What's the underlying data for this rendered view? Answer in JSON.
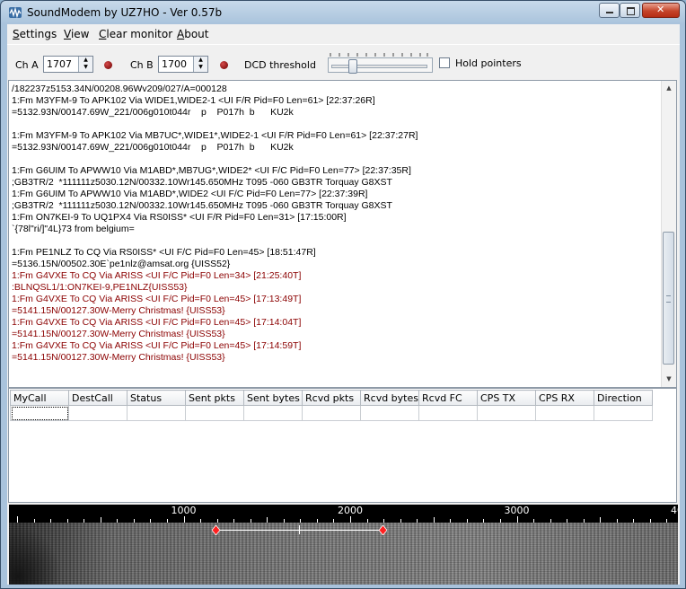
{
  "window": {
    "title": "SoundModem by UZ7HO - Ver 0.57b"
  },
  "menu": [
    {
      "label": "Settings",
      "key": "S"
    },
    {
      "label": "View",
      "key": "V"
    },
    {
      "label": "Clear monitor",
      "key": "C"
    },
    {
      "label": "About",
      "key": "A"
    }
  ],
  "toolbar": {
    "cha_label": "Ch A",
    "cha_value": "1707",
    "chb_label": "Ch B",
    "chb_value": "1700",
    "dcd_label": "DCD threshold",
    "dcd_level": 0.2,
    "hold_label": "Hold pointers",
    "hold_checked": false
  },
  "monitor": {
    "lines": [
      {
        "text": "/182237z5153.34N/00208.96Wv209/027/A=000128",
        "color": "black"
      },
      {
        "text": "1:Fm M3YFM-9 To APK102 Via WIDE1,WIDE2-1 <UI F/R Pid=F0 Len=61> [22:37:26R]",
        "color": "black"
      },
      {
        "text": "=5132.93N/00147.69W_221/006g010t044r    p    P017h  b      KU2k",
        "color": "black"
      },
      {
        "text": "",
        "color": "black"
      },
      {
        "text": "1:Fm M3YFM-9 To APK102 Via MB7UC*,WIDE1*,WIDE2-1 <UI F/R Pid=F0 Len=61> [22:37:27R]",
        "color": "black"
      },
      {
        "text": "=5132.93N/00147.69W_221/006g010t044r    p    P017h  b      KU2k",
        "color": "black"
      },
      {
        "text": "",
        "color": "black"
      },
      {
        "text": "1:Fm G6UIM To APWW10 Via M1ABD*,MB7UG*,WIDE2* <UI F/C Pid=F0 Len=77> [22:37:35R]",
        "color": "black"
      },
      {
        "text": ";GB3TR/2  *111111z5030.12N/00332.10Wr145.650MHz T095 -060 GB3TR Torquay G8XST",
        "color": "black"
      },
      {
        "text": "1:Fm G6UIM To APWW10 Via M1ABD*,WIDE2 <UI F/C Pid=F0 Len=77> [22:37:39R]",
        "color": "black"
      },
      {
        "text": ";GB3TR/2  *111111z5030.12N/00332.10Wr145.650MHz T095 -060 GB3TR Torquay G8XST",
        "color": "black"
      },
      {
        "text": "1:Fm ON7KEI-9 To UQ1PX4 Via RS0ISS* <UI F/R Pid=F0 Len=31> [17:15:00R]",
        "color": "black"
      },
      {
        "text": "`{78l\"ri/]\"4L}73 from belgium=",
        "color": "black"
      },
      {
        "text": "",
        "color": "black"
      },
      {
        "text": "1:Fm PE1NLZ To CQ Via RS0ISS* <UI F/C Pid=F0 Len=45> [18:51:47R]",
        "color": "black"
      },
      {
        "text": "=5136.15N/00502.30E`pe1nlz@amsat.org {UISS52}",
        "color": "black"
      },
      {
        "text": "1:Fm G4VXE To CQ Via ARISS <UI F/C Pid=F0 Len=34> [21:25:40T]",
        "color": "red"
      },
      {
        "text": ":BLNQSL1/1:ON7KEI-9,PE1NLZ{UISS53}",
        "color": "red"
      },
      {
        "text": "1:Fm G4VXE To CQ Via ARISS <UI F/C Pid=F0 Len=45> [17:13:49T]",
        "color": "red"
      },
      {
        "text": "=5141.15N/00127.30W-Merry Christmas! {UISS53}",
        "color": "red"
      },
      {
        "text": "1:Fm G4VXE To CQ Via ARISS <UI F/C Pid=F0 Len=45> [17:14:04T]",
        "color": "red"
      },
      {
        "text": "=5141.15N/00127.30W-Merry Christmas! {UISS53}",
        "color": "red"
      },
      {
        "text": "1:Fm G4VXE To CQ Via ARISS <UI F/C Pid=F0 Len=45> [17:14:59T]",
        "color": "red"
      },
      {
        "text": "=5141.15N/00127.30W-Merry Christmas! {UISS53}",
        "color": "red"
      }
    ]
  },
  "grid": {
    "columns": [
      "MyCall",
      "DestCall",
      "Status",
      "Sent pkts",
      "Sent bytes",
      "Rcvd pkts",
      "Rcvd bytes",
      "Rcvd FC",
      "CPS TX",
      "CPS RX",
      "Direction"
    ]
  },
  "waterfall": {
    "axis_labels": [
      "1000",
      "2000",
      "3000",
      "4000"
    ],
    "cha_freq": 1707,
    "chb_freq": 1700
  },
  "colors": {
    "rx_text": "#000000",
    "tx_text": "#8b0000",
    "marker": "#ff2020"
  }
}
